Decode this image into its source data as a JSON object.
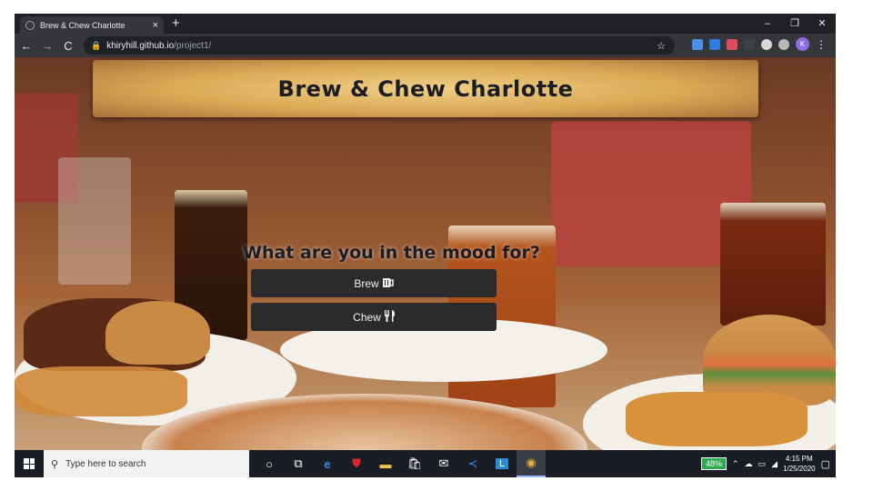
{
  "browser": {
    "tab_title": "Brew & Chew Charlotte",
    "tab_close": "×",
    "new_tab": "+",
    "window_controls": [
      "–",
      "❐",
      "✕"
    ],
    "nav": {
      "back": "←",
      "forward": "→",
      "reload": "C"
    },
    "url_host": "khiryhill.github.io",
    "url_path": "/project1/",
    "profile_initial": "K",
    "menu": "⋮"
  },
  "page": {
    "site_title": "Brew & Chew Charlotte",
    "question": "What are you in the mood for?",
    "brew_label": "Brew",
    "chew_label": "Chew"
  },
  "taskbar": {
    "search_placeholder": "Type here to search",
    "battery": "48%",
    "time": "4:15 PM",
    "date": "1/25/2020"
  },
  "colors": {
    "banner": "#e2b869",
    "button_bg": "#2b2b2d",
    "chrome_dark": "#202124",
    "chrome_toolbar": "#35363a"
  }
}
